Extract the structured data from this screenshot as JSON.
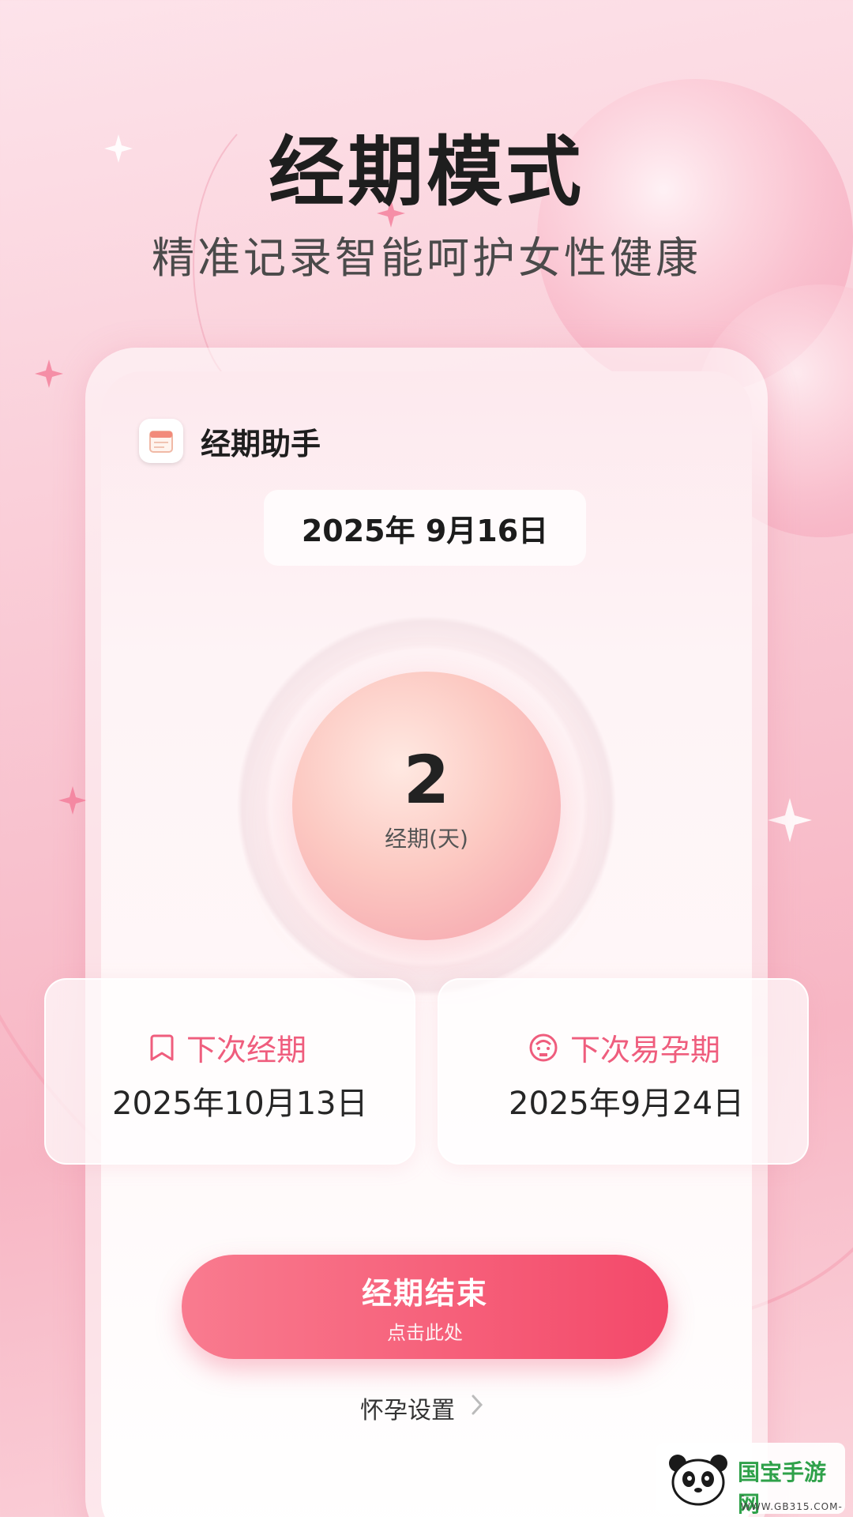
{
  "hero": {
    "title": "经期模式",
    "subtitle": "精准记录智能呵护女性健康"
  },
  "app": {
    "name": "经期助手",
    "logo_icon": "calendar-icon"
  },
  "date": {
    "current": "2025年 9月16日"
  },
  "period": {
    "days": "2",
    "label": "经期(天)"
  },
  "next_period": {
    "title": "下次经期",
    "date": "2025年10月13日",
    "icon": "bookmark-icon"
  },
  "next_fertile": {
    "title": "下次易孕期",
    "date": "2025年9月24日",
    "icon": "baby-face-icon"
  },
  "end_button": {
    "label": "经期结束",
    "hint": "点击此处"
  },
  "pregnancy_settings": {
    "label": "怀孕设置",
    "icon": "chevron-right-icon"
  },
  "watermark": {
    "text": "国宝手游网",
    "url": "-WWW.GB315.COM-"
  },
  "colors": {
    "accent": "#f3496a",
    "accent_text": "#ef5d7d",
    "background": "#f9c9d4"
  }
}
